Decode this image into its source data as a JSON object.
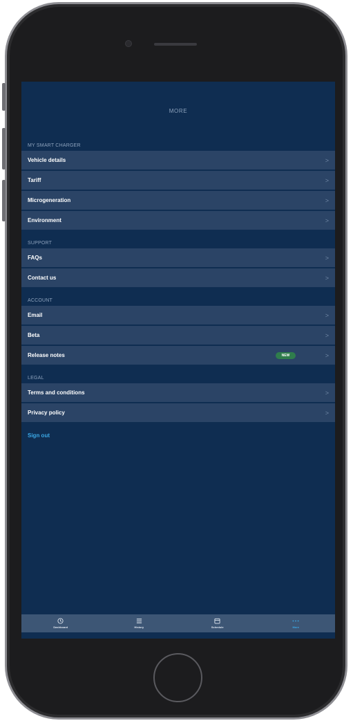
{
  "header": {
    "title": "MORE"
  },
  "sections": [
    {
      "title": "MY SMART CHARGER",
      "items": [
        {
          "label": "Vehicle details"
        },
        {
          "label": "Tariff"
        },
        {
          "label": "Microgeneration"
        },
        {
          "label": "Environment"
        }
      ]
    },
    {
      "title": "SUPPORT",
      "items": [
        {
          "label": "FAQs"
        },
        {
          "label": "Contact us"
        }
      ]
    },
    {
      "title": "ACCOUNT",
      "items": [
        {
          "label": "Email"
        },
        {
          "label": "Beta"
        },
        {
          "label": "Release notes",
          "badge": "NEW"
        }
      ]
    },
    {
      "title": "LEGAL",
      "items": [
        {
          "label": "Terms and conditions"
        },
        {
          "label": "Privacy policy"
        }
      ]
    }
  ],
  "chevron": ">",
  "sign_out": "Sign out",
  "tabbar": {
    "tabs": [
      {
        "label": "Dashboard",
        "icon": "clock-icon"
      },
      {
        "label": "History",
        "icon": "list-icon"
      },
      {
        "label": "Schedule",
        "icon": "calendar-icon"
      },
      {
        "label": "More",
        "icon": "more-icon",
        "active": true
      }
    ]
  },
  "colors": {
    "background": "#0f2d51",
    "row": "#2b4466",
    "accent": "#3ba8e6",
    "badge": "#2f7d4c",
    "tabbar": "#3d5675"
  }
}
